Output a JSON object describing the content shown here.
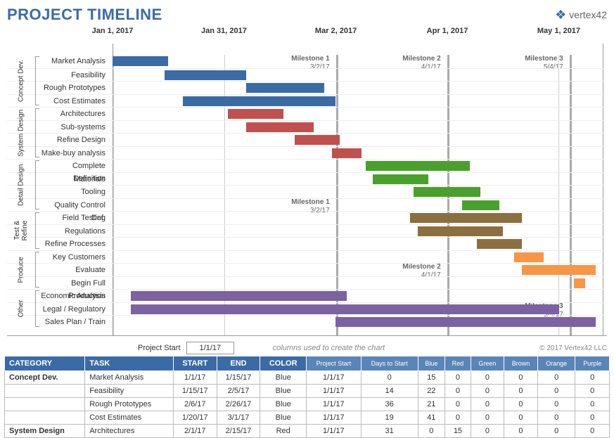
{
  "title": "PROJECT TIMELINE",
  "logo": "vertex42",
  "project_start_label": "Project Start",
  "project_start_value": "1/1/17",
  "note": "columns used to create the chart",
  "copyright": "© 2017 Vertex42 LLC",
  "table_headers": {
    "category": "CATEGORY",
    "task": "TASK",
    "start": "START",
    "end": "END",
    "color": "COLOR",
    "pstart": "Project Start",
    "days": "Days to Start",
    "blue": "Blue",
    "red": "Red",
    "green": "Green",
    "brown": "Brown",
    "orange": "Orange",
    "purple": "Purple"
  },
  "chart_data": {
    "type": "gantt",
    "title": "Project Timeline",
    "x_range": [
      "2017-01-01",
      "2017-05-14"
    ],
    "x_ticks": [
      {
        "label": "Jan 1, 2017",
        "pos": 0
      },
      {
        "label": "Jan 31, 2017",
        "pos": 22.7
      },
      {
        "label": "Mar 2, 2017",
        "pos": 45.5
      },
      {
        "label": "Apr 1, 2017",
        "pos": 68.2
      },
      {
        "label": "May 1, 2017",
        "pos": 90.9
      }
    ],
    "milestones": [
      {
        "name": "Milestone 1",
        "date": "3/2/17",
        "pos": 45.5,
        "label_rows": [
          0,
          11
        ]
      },
      {
        "name": "Milestone 2",
        "date": "4/1/17",
        "pos": 68.2,
        "label_rows": [
          0,
          16
        ]
      },
      {
        "name": "Milestone 3",
        "date": "5/4/17",
        "pos": 93.2,
        "label_rows": [
          0,
          19
        ]
      }
    ],
    "groups": [
      {
        "name": "Concept Dev.",
        "rows": [
          0,
          3
        ]
      },
      {
        "name": "System Design",
        "rows": [
          4,
          7
        ]
      },
      {
        "name": "Detail Design",
        "rows": [
          8,
          11
        ]
      },
      {
        "name": "Test & Refine",
        "rows": [
          12,
          14
        ]
      },
      {
        "name": "Produce",
        "rows": [
          15,
          17
        ]
      },
      {
        "name": "Other",
        "rows": [
          18,
          20
        ]
      }
    ],
    "tasks": [
      {
        "label": "Market Analysis",
        "start": 0,
        "dur": 15,
        "color": "blue"
      },
      {
        "label": "Feasibility",
        "start": 14,
        "dur": 22,
        "color": "blue"
      },
      {
        "label": "Rough Prototypes",
        "start": 36,
        "dur": 21,
        "color": "blue"
      },
      {
        "label": "Cost Estimates",
        "start": 19,
        "dur": 41,
        "color": "blue"
      },
      {
        "label": "Architectures",
        "start": 31,
        "dur": 15,
        "color": "red"
      },
      {
        "label": "Sub-systems",
        "start": 36,
        "dur": 18,
        "color": "red"
      },
      {
        "label": "Refine Design",
        "start": 49,
        "dur": 12,
        "color": "red"
      },
      {
        "label": "Make-buy analysis",
        "start": 59,
        "dur": 8,
        "color": "red"
      },
      {
        "label": "Complete Definition",
        "start": 68,
        "dur": 28,
        "color": "green"
      },
      {
        "label": "Materials",
        "start": 70,
        "dur": 15,
        "color": "green"
      },
      {
        "label": "Tooling",
        "start": 81,
        "dur": 18,
        "color": "green"
      },
      {
        "label": "Quality Control Def.",
        "start": 94,
        "dur": 10,
        "color": "green"
      },
      {
        "label": "Field Testing",
        "start": 80,
        "dur": 30,
        "color": "brown"
      },
      {
        "label": "Regulations",
        "start": 82,
        "dur": 23,
        "color": "brown"
      },
      {
        "label": "Refine Processes",
        "start": 98,
        "dur": 12,
        "color": "brown"
      },
      {
        "label": "Key Customers",
        "start": 108,
        "dur": 8,
        "color": "orange"
      },
      {
        "label": "Evaluate",
        "start": 110,
        "dur": 20,
        "color": "orange"
      },
      {
        "label": "Begin Full Production",
        "start": 124,
        "dur": 3,
        "color": "orange"
      },
      {
        "label": "Economic Analysis",
        "start": 5,
        "dur": 58,
        "color": "purple"
      },
      {
        "label": "Legal / Regulatory",
        "start": 5,
        "dur": 115,
        "color": "purple"
      },
      {
        "label": "Sales Plan / Train",
        "start": 60,
        "dur": 70,
        "color": "purple"
      }
    ],
    "total_days": 132
  },
  "table_rows": [
    {
      "cat": "Concept Dev.",
      "task": "Market Analysis",
      "start": "1/1/17",
      "end": "1/15/17",
      "color": "Blue",
      "ps": "1/1/17",
      "days": 0,
      "vals": [
        15,
        0,
        0,
        0,
        0,
        0
      ]
    },
    {
      "cat": "",
      "task": "Feasibility",
      "start": "1/15/17",
      "end": "2/5/17",
      "color": "Blue",
      "ps": "1/1/17",
      "days": 14,
      "vals": [
        22,
        0,
        0,
        0,
        0,
        0
      ]
    },
    {
      "cat": "",
      "task": "Rough Prototypes",
      "start": "2/6/17",
      "end": "2/26/17",
      "color": "Blue",
      "ps": "1/1/17",
      "days": 36,
      "vals": [
        21,
        0,
        0,
        0,
        0,
        0
      ]
    },
    {
      "cat": "",
      "task": "Cost Estimates",
      "start": "1/20/17",
      "end": "3/1/17",
      "color": "Blue",
      "ps": "1/1/17",
      "days": 19,
      "vals": [
        41,
        0,
        0,
        0,
        0,
        0
      ]
    },
    {
      "cat": "System Design",
      "task": "Architectures",
      "start": "2/1/17",
      "end": "2/15/17",
      "color": "Red",
      "ps": "1/1/17",
      "days": 31,
      "vals": [
        0,
        15,
        0,
        0,
        0,
        0
      ]
    }
  ]
}
